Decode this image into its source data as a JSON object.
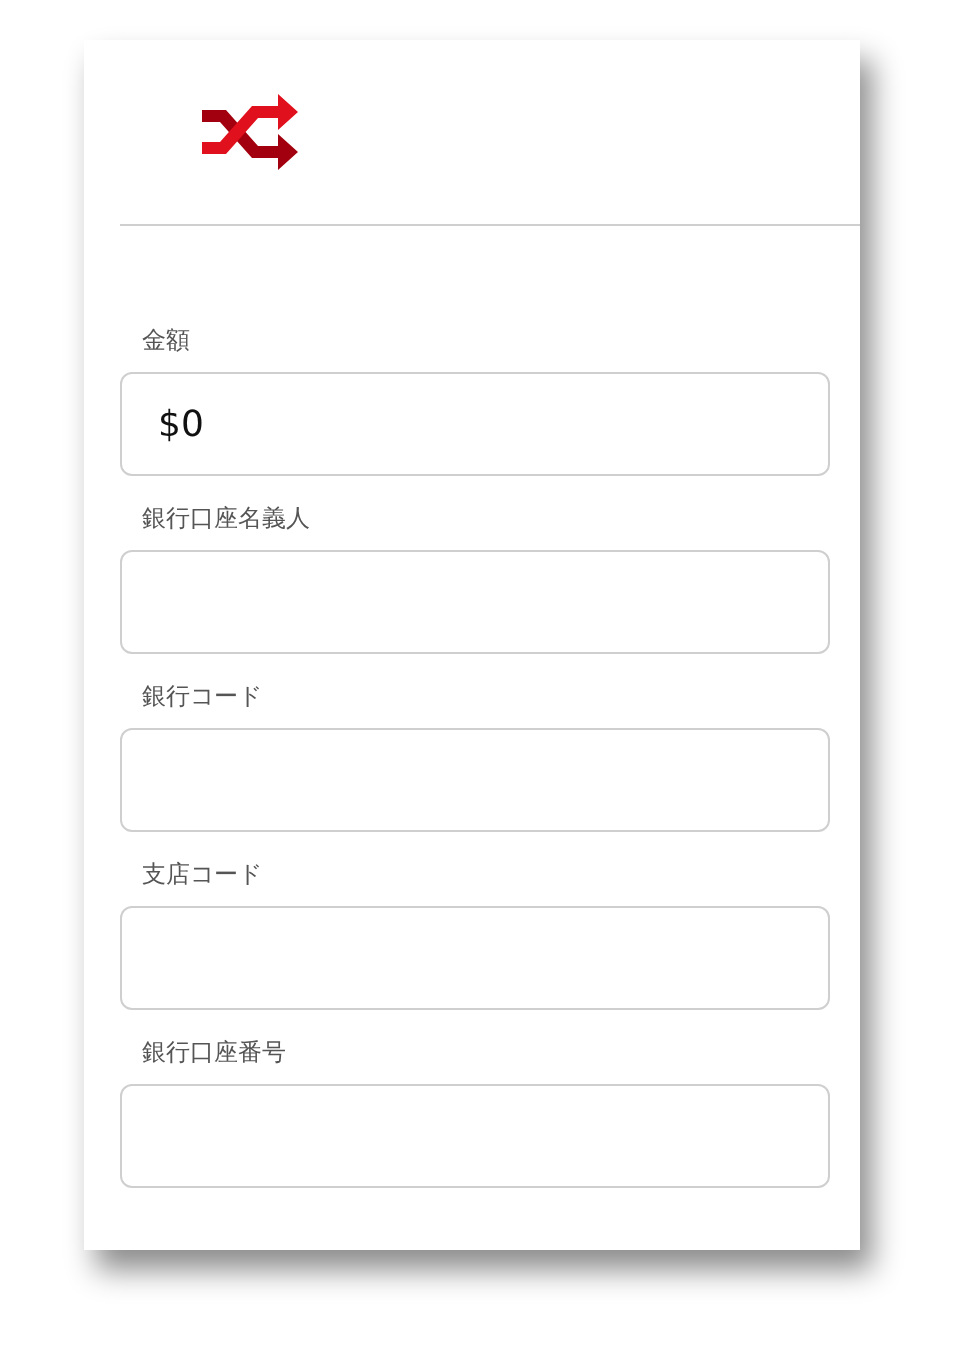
{
  "fields": [
    {
      "label": "金額",
      "value": "$0"
    },
    {
      "label": "銀行口座名義人"
    },
    {
      "label": "銀行コード"
    },
    {
      "label": "支店コード"
    },
    {
      "label": "銀行口座番号"
    }
  ]
}
